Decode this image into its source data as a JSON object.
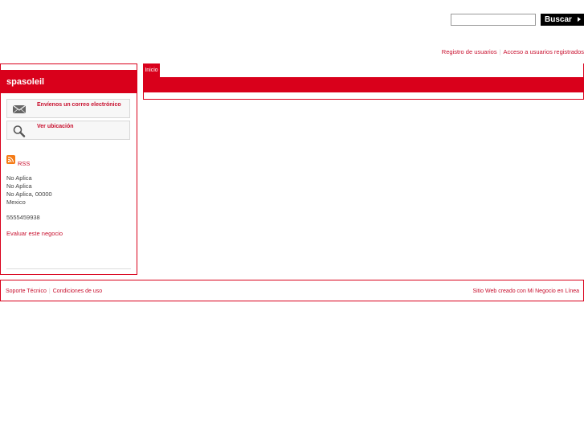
{
  "header": {
    "search": {
      "value": "",
      "placeholder": "",
      "button_label": "Buscar"
    },
    "user_links": [
      "Registro de usuarios",
      "Acceso a usuarios registrados"
    ]
  },
  "sidebar": {
    "business_name": "spasoleil",
    "actions": [
      {
        "label": "Envíenos un correo electrónico",
        "icon": "envelope-icon"
      },
      {
        "label": "Ver ubicación",
        "icon": "magnifier-icon"
      }
    ],
    "rss_label": "RSS",
    "address": [
      "No Aplica",
      "No Aplica",
      "No Aplica, 00000",
      "Mexico"
    ],
    "phone": "5555459938",
    "rate_link": "Evaluar este negocio"
  },
  "main": {
    "tabs": [
      {
        "label": "Inicio",
        "active": true
      }
    ]
  },
  "footer": {
    "left_links": [
      "Soporte Técnico",
      "Condiciones de uso"
    ],
    "right_text": "Sitio Web creado con Mi Negocio en Línea"
  },
  "colors": {
    "accent": "#d9001b",
    "link": "#c8102e",
    "rss": "#f57b16"
  }
}
